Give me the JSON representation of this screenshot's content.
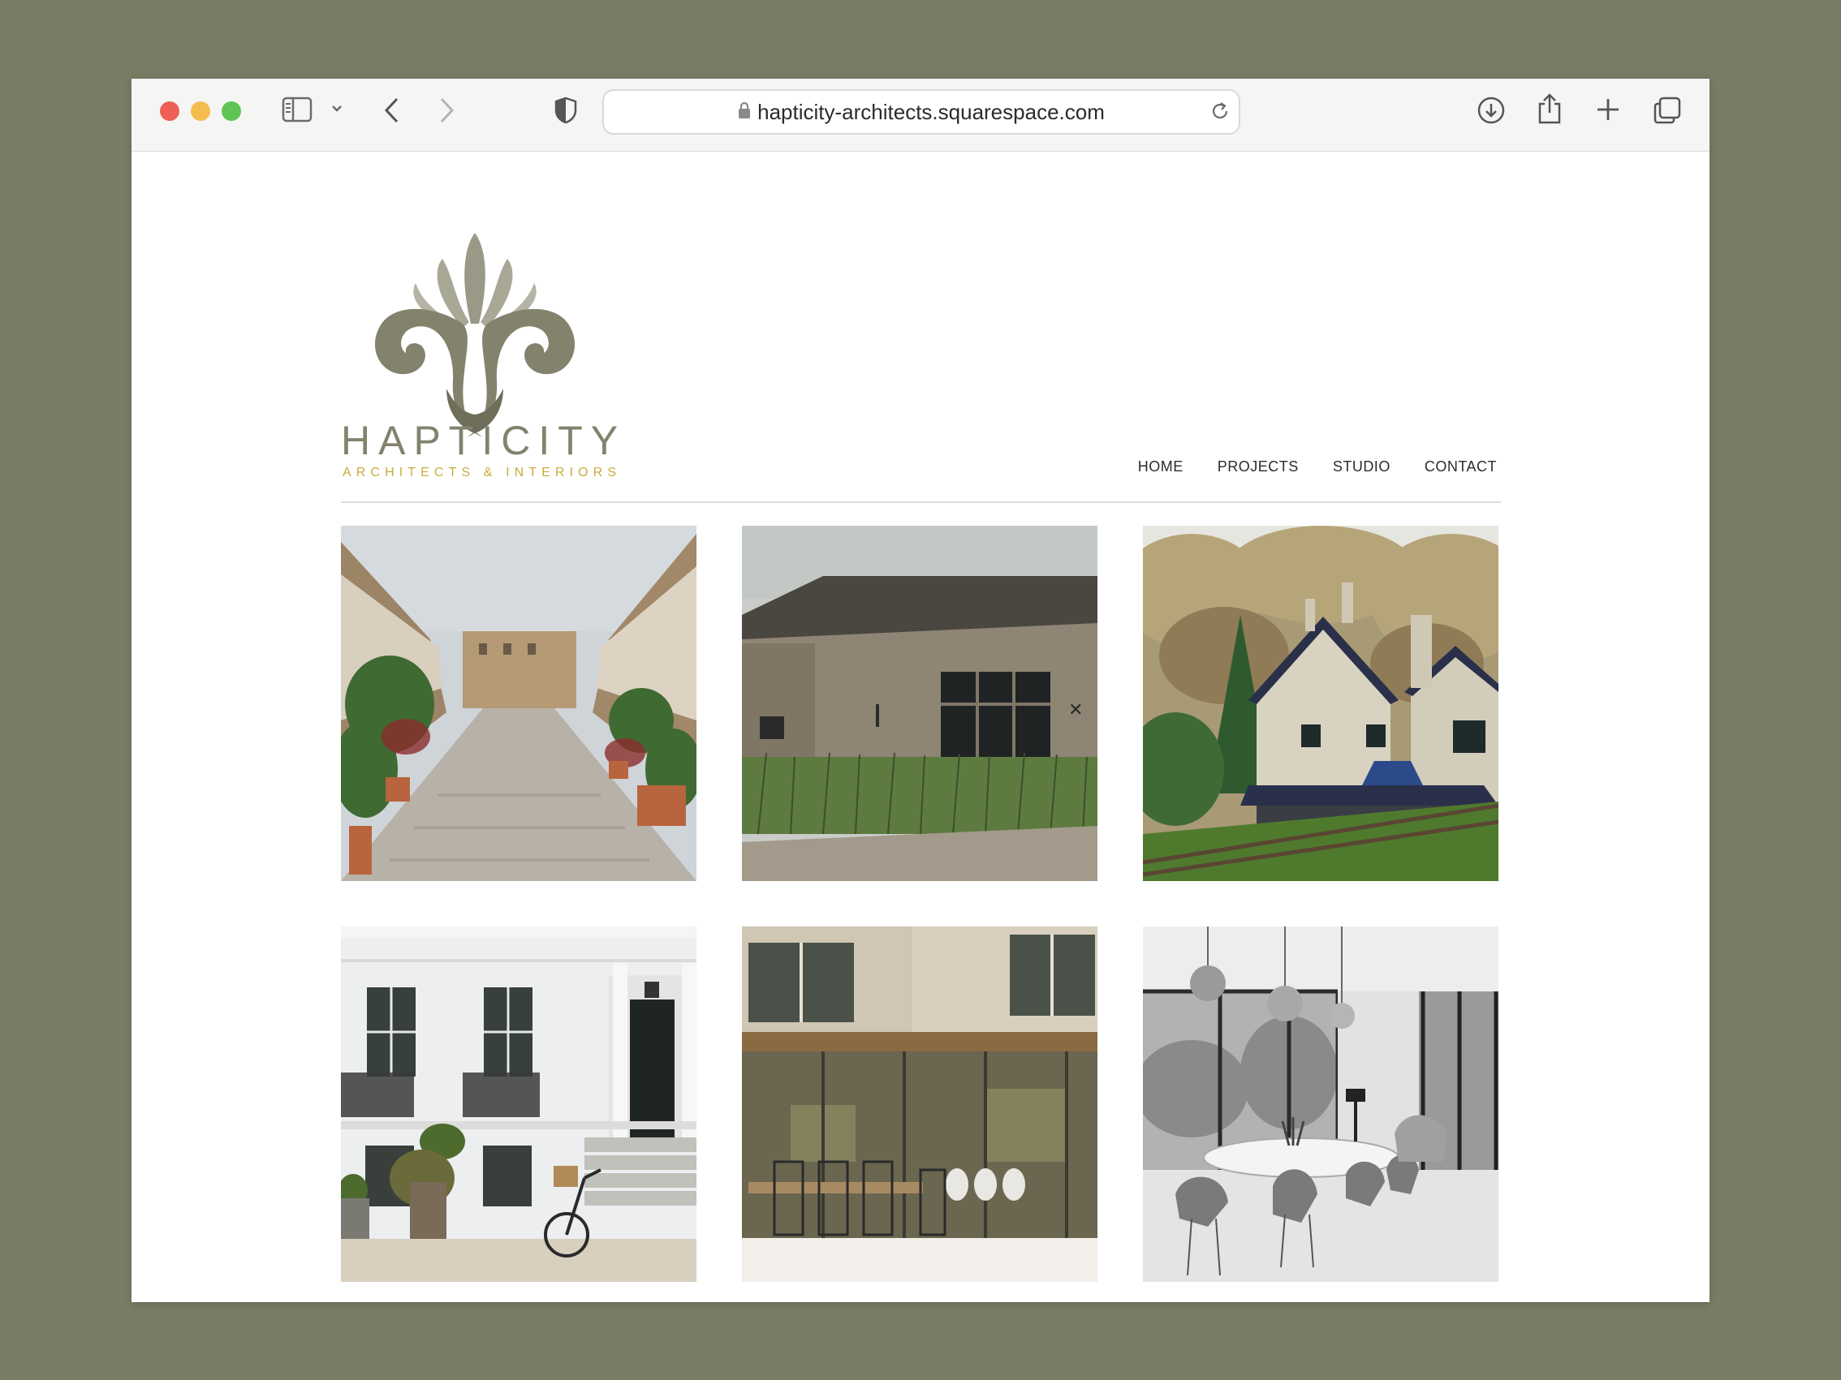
{
  "browser": {
    "url": "hapticity-architects.squarespace.com",
    "icons": [
      "sidebar-icon",
      "chevron-down-icon",
      "back-icon",
      "forward-icon",
      "shield-icon",
      "lock-icon",
      "reload-icon",
      "download-icon",
      "share-icon",
      "new-tab-icon",
      "tabs-overview-icon"
    ]
  },
  "site": {
    "logo_word": "HAPTICITY",
    "logo_sub": "ARCHITECTS & INTERIORS",
    "nav": [
      {
        "label": "HOME"
      },
      {
        "label": "PROJECTS"
      },
      {
        "label": "STUDIO"
      },
      {
        "label": "CONTACT"
      }
    ]
  },
  "colors": {
    "logo_olive": "#83826c",
    "logo_gold": "#c9ac3d",
    "backdrop": "#7a7c65"
  }
}
